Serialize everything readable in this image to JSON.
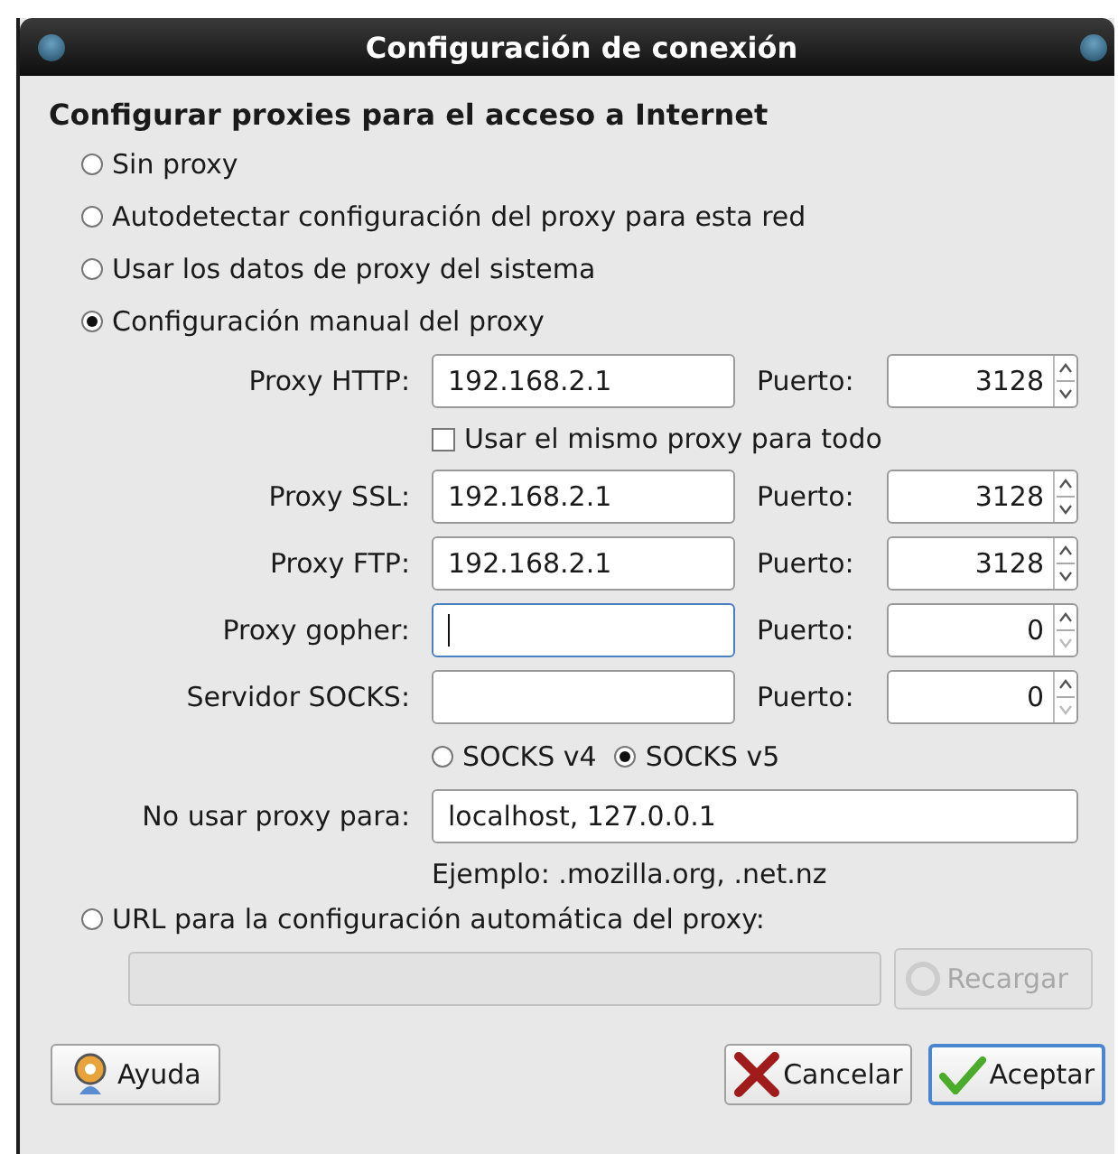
{
  "window": {
    "title": "Configuración de conexión"
  },
  "heading": "Configurar proxies para el acceso a Internet",
  "modes": [
    {
      "label": "Sin proxy",
      "selected": false
    },
    {
      "label": "Autodetectar configuración del proxy para esta red",
      "selected": false
    },
    {
      "label": "Usar los datos de proxy del sistema",
      "selected": false
    },
    {
      "label": "Configuración manual del proxy",
      "selected": true
    }
  ],
  "proxies": [
    {
      "label": "Proxy HTTP:",
      "host": "192.168.2.1",
      "port_label": "Puerto:",
      "port": "3128",
      "focused": false
    },
    {
      "label": "Proxy SSL:",
      "host": "192.168.2.1",
      "port_label": "Puerto:",
      "port": "3128",
      "focused": false
    },
    {
      "label": "Proxy FTP:",
      "host": "192.168.2.1",
      "port_label": "Puerto:",
      "port": "3128",
      "focused": false
    },
    {
      "label": "Proxy gopher:",
      "port_label": "Puerto:",
      "port": "0",
      "focused": true
    },
    {
      "label": "Servidor SOCKS:",
      "port_label": "Puerto:",
      "port": "0",
      "focused": false
    }
  ],
  "same_proxy": {
    "label": "Usar el mismo proxy para todo",
    "checked": false
  },
  "socks_versions": [
    {
      "label": "SOCKS v4",
      "selected": false
    },
    {
      "label": "SOCKS v5",
      "selected": true
    }
  ],
  "no_proxy": {
    "label": "No usar proxy para:",
    "value": "localhost, 127.0.0.1",
    "hint": "Ejemplo: .mozilla.org, .net.nz"
  },
  "auto_url": {
    "label": "URL para la configuración automática del proxy:",
    "selected": false,
    "disabled": true,
    "reload_label": "Recargar"
  },
  "buttons": [
    {
      "label": "Ayuda",
      "kind": "help"
    },
    {
      "label": "Cancelar",
      "kind": "cancel"
    },
    {
      "label": "Aceptar",
      "kind": "accept"
    }
  ]
}
